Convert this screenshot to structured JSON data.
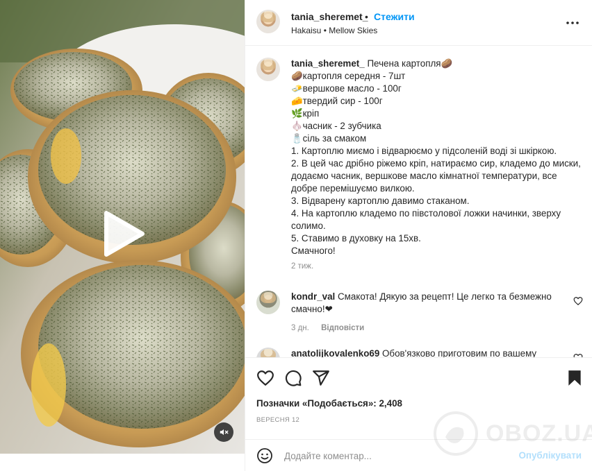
{
  "post": {
    "author": "tania_sheremet_",
    "follow_label": "Стежити",
    "audio": "Hakaisu • Mellow Skies",
    "caption_title": "Печена картопля🥔",
    "caption_lines": [
      "🥔картопля середня - 7шт",
      "🧈вершкове масло - 100г",
      "🧀твердий сир - 100г",
      "🌿кріп",
      "🧄часник - 2 зубчика",
      "🧂сіль за смаком",
      "1. Картоплю миємо і відварюємо у підсоленій воді зі шкіркою.",
      "2. В цей час дрібно ріжемо кріп, натираємо сир, кладемо до миски, додаємо часник, вершкове масло кімнатної температури, все добре перемішуємо вилкою.",
      "3. Відварену картоплю давимо стаканом.",
      "4. На картоплю кладемо по півстолової ложки начинки, зверху солимо.",
      "5. Ставимо в духовку на 15хв.",
      "Смачного!"
    ],
    "caption_time": "2 тиж.",
    "likes_text": "Позначки «Подобається»: 2,408",
    "date": "ВЕРЕСНЯ 12"
  },
  "comments": [
    {
      "user": "kondr_val",
      "text": "Смакота! Дякую за рецепт! Це легко та безмежно смачно!❤",
      "time": "3 дн.",
      "reply_label": "Відповісти"
    },
    {
      "user": "anatolijkovalenko69",
      "text": "Обов'язково приготовим по вашему"
    }
  ],
  "composer": {
    "placeholder": "Додайте коментар...",
    "publish_label": "Опублікувати"
  },
  "watermark": "OBOZ.UA",
  "icons": {
    "more": "more-horizontal-icon",
    "like": "heart-icon",
    "comment": "comment-icon",
    "share": "share-icon",
    "save": "bookmark-icon",
    "emoji": "emoji-icon",
    "play": "play-icon",
    "mute": "mute-icon"
  },
  "colors": {
    "link_blue": "#0095f6",
    "publish_disabled": "#b2dffc",
    "muted_text": "#8e8e8e"
  }
}
